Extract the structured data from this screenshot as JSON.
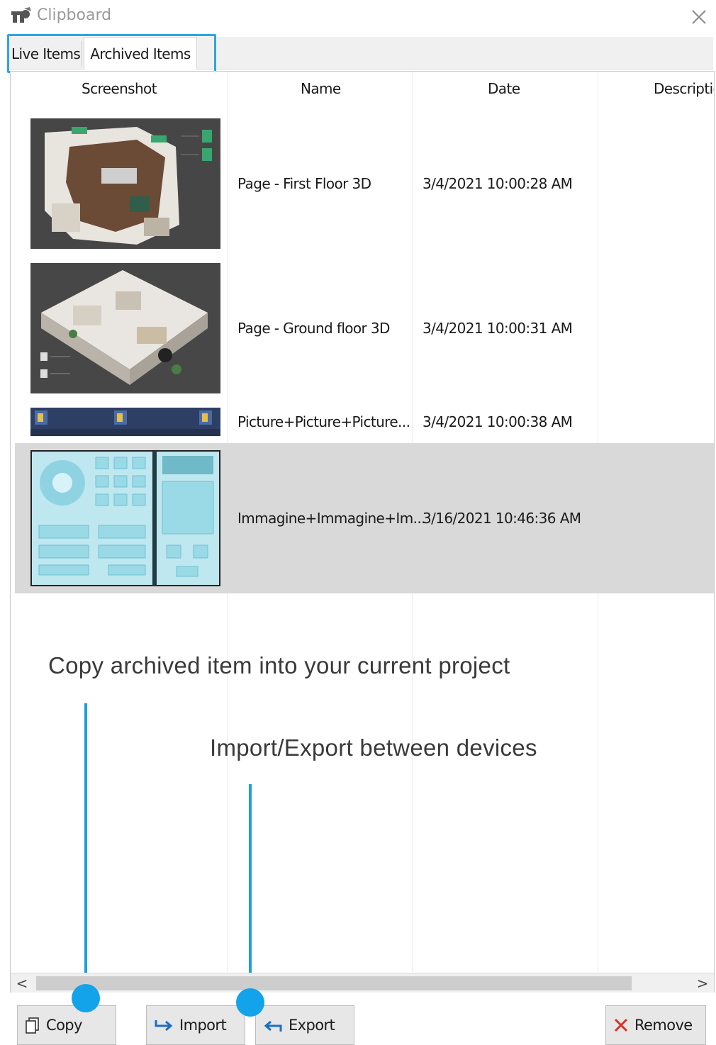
{
  "window": {
    "title": "Clipboard",
    "logo_icon": "tp-logo-icon",
    "close_icon": "close-icon"
  },
  "tabs": [
    {
      "label": "Live Items",
      "active": false
    },
    {
      "label": "Archived Items",
      "active": true
    }
  ],
  "table": {
    "columns": [
      "Screenshot",
      "Name",
      "Date",
      "Descriptic"
    ],
    "rows": [
      {
        "name": "Page - First Floor 3D",
        "date": "3/4/2021 10:00:28 AM",
        "selected": false
      },
      {
        "name": "Page - Ground floor 3D",
        "date": "3/4/2021 10:00:31 AM",
        "selected": false
      },
      {
        "name": "Picture+Picture+Picture...",
        "date": "3/4/2021 10:00:38 AM",
        "selected": false
      },
      {
        "name": "Immagine+Immagine+Im...",
        "date": "3/16/2021 10:46:36 AM",
        "selected": true
      }
    ]
  },
  "annotations": {
    "copy_hint": "Copy archived item into your current project",
    "import_export_hint": "Import/Export between devices"
  },
  "scrollbar": {
    "left_arrow": "<",
    "right_arrow": ">"
  },
  "buttons": {
    "copy": "Copy",
    "import": "Import",
    "export": "Export",
    "remove": "Remove"
  },
  "colors": {
    "accent": "#2ea6de",
    "pointer": "#12a3ea",
    "selected_row": "#d9d9d9",
    "remove_icon": "#d93025"
  }
}
